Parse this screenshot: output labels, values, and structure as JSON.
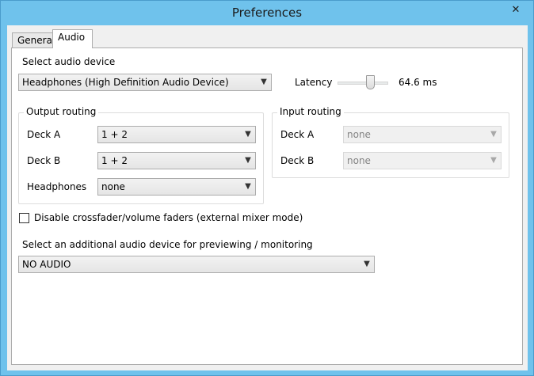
{
  "window": {
    "title": "Preferences",
    "close_glyph": "✕"
  },
  "tabs": [
    {
      "label": "General",
      "active": false
    },
    {
      "label": "Audio",
      "active": true
    }
  ],
  "audio": {
    "device_label": "Select audio device",
    "device_value": "Headphones (High Definition Audio Device)",
    "latency_label": "Latency",
    "latency_value": "64.6 ms",
    "latency_slider_fraction": 0.65,
    "output_routing": {
      "title": "Output routing",
      "rows": [
        {
          "label": "Deck A",
          "value": "1 + 2"
        },
        {
          "label": "Deck B",
          "value": "1 + 2"
        },
        {
          "label": "Headphones",
          "value": "none"
        }
      ]
    },
    "input_routing": {
      "title": "Input routing",
      "rows": [
        {
          "label": "Deck A",
          "value": "none",
          "disabled": true
        },
        {
          "label": "Deck B",
          "value": "none",
          "disabled": true
        }
      ]
    },
    "crossfader_checkbox": {
      "label": "Disable crossfader/volume faders (external mixer mode)",
      "checked": false
    },
    "preview_label": "Select an additional audio device for previewing / monitoring",
    "preview_value": "NO AUDIO"
  },
  "icons": {
    "dropdown": "chevron-down-icon",
    "close": "close-icon"
  },
  "colors": {
    "frame": "#6fc2ec",
    "client_bg": "#f0f0f0",
    "panel_bg": "#ffffff"
  }
}
